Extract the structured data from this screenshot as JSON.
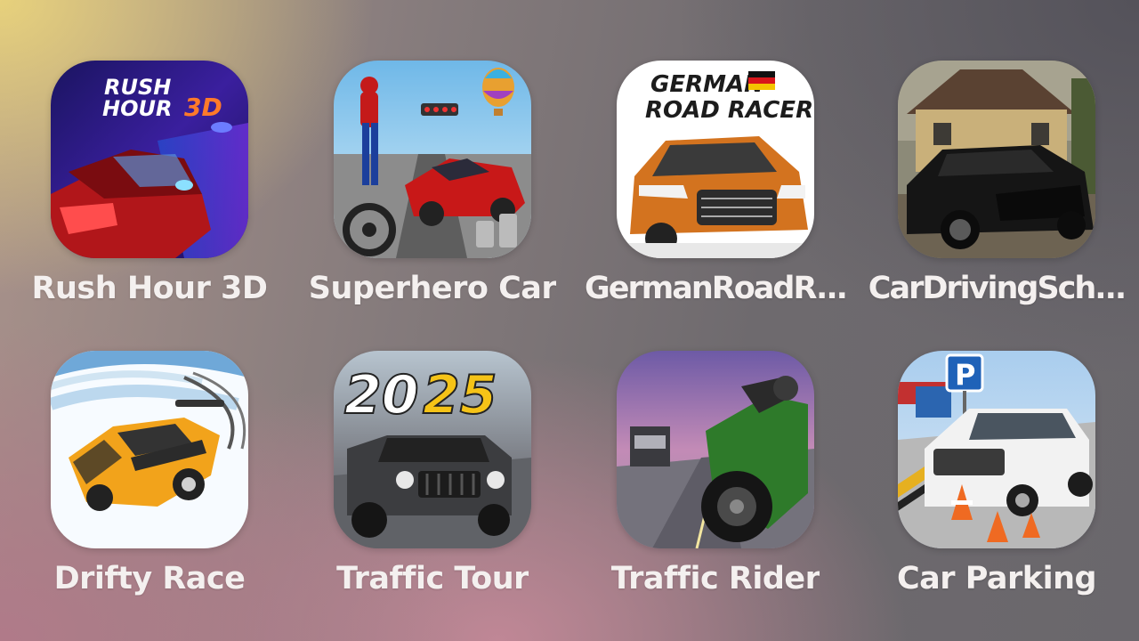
{
  "apps": [
    {
      "label": "Rush Hour 3D",
      "icon_text_line1": "RUSH",
      "icon_text_line2": "HOUR",
      "icon_text_3d": "3D"
    },
    {
      "label": "Superhero Car"
    },
    {
      "label": "GermanRoadR...",
      "icon_text_line1": "GERMAN",
      "icon_text_line2": "ROAD RACER"
    },
    {
      "label": "CarDrivingSch..."
    },
    {
      "label": "Drifty Race"
    },
    {
      "label": "Traffic Tour",
      "icon_year_left": "20",
      "icon_year_right": "25"
    },
    {
      "label": "Traffic Rider"
    },
    {
      "label": "Car Parking",
      "icon_sign": "P"
    }
  ],
  "colors": {
    "label_text": "#f4f0ef",
    "rush_hour_bg": "#2a1f7a",
    "superhero_sky": "#8cc9ea",
    "german_bg": "#ffffff",
    "german_car": "#d3731f",
    "driving_school_bg": "#6d6a52",
    "drifty_bg": "#f7fbff",
    "drifty_car": "#f2a31b",
    "traffic_tour_bg": "#6d6f76",
    "traffic_rider_sky": "#8b6fa8",
    "parking_sign": "#1f62b8"
  }
}
